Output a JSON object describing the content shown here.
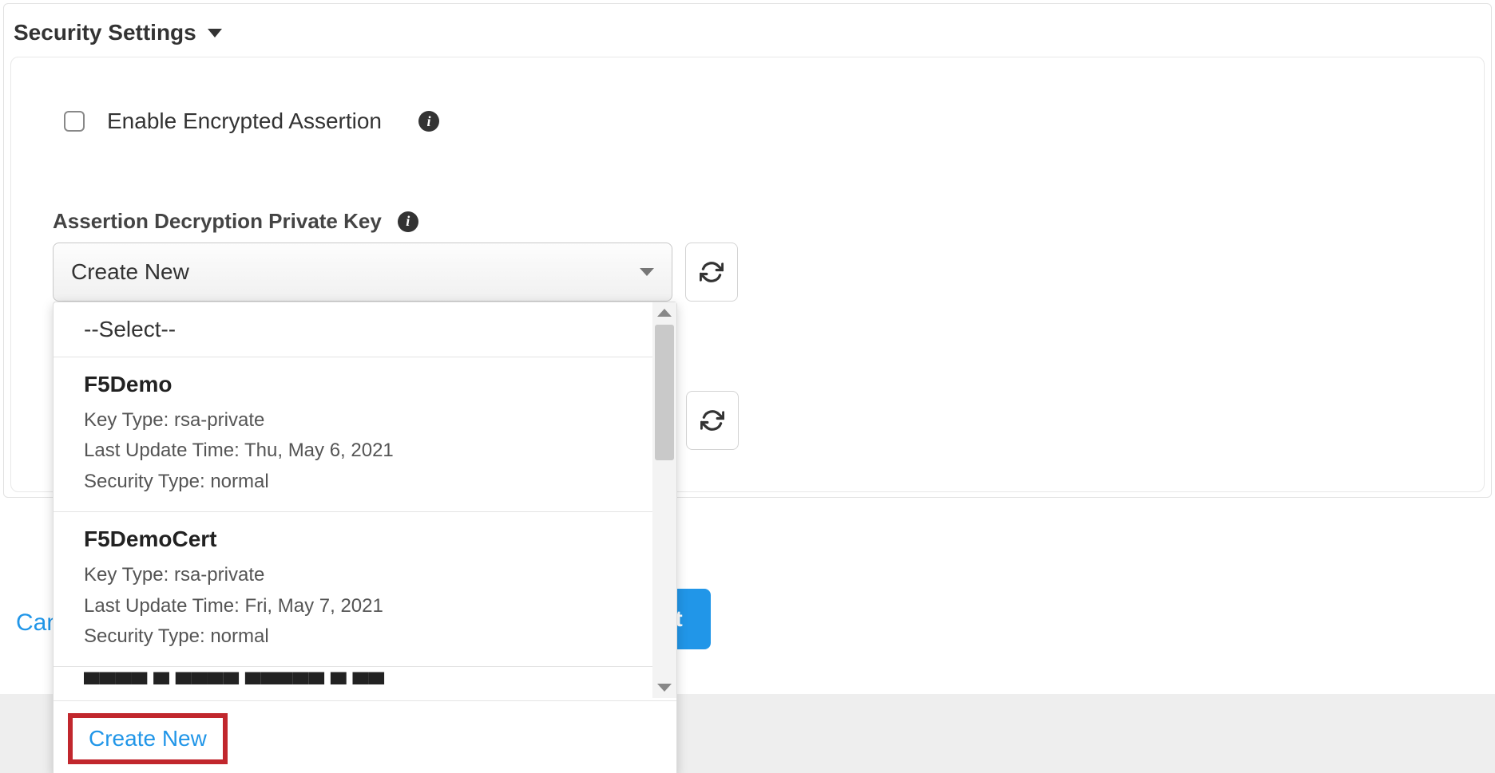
{
  "section": {
    "title": "Security Settings"
  },
  "encrypted": {
    "label": "Enable Encrypted Assertion"
  },
  "privateKey": {
    "label": "Assertion Decryption Private Key",
    "selected": "Create New"
  },
  "dropdown": {
    "placeholder": "--Select--",
    "items": [
      {
        "title": "F5Demo",
        "keyTypeLabel": "Key Type:",
        "keyType": "rsa-private",
        "lastUpdateLabel": "Last Update Time:",
        "lastUpdate": "Thu, May 6, 2021",
        "securityTypeLabel": "Security Type:",
        "securityType": "normal"
      },
      {
        "title": "F5DemoCert",
        "keyTypeLabel": "Key Type:",
        "keyType": "rsa-private",
        "lastUpdateLabel": "Last Update Time:",
        "lastUpdate": "Fri, May 7, 2021",
        "securityTypeLabel": "Security Type:",
        "securityType": "normal"
      }
    ],
    "createNew": "Create New"
  },
  "footer": {
    "cancel": "Can",
    "next": "t"
  }
}
